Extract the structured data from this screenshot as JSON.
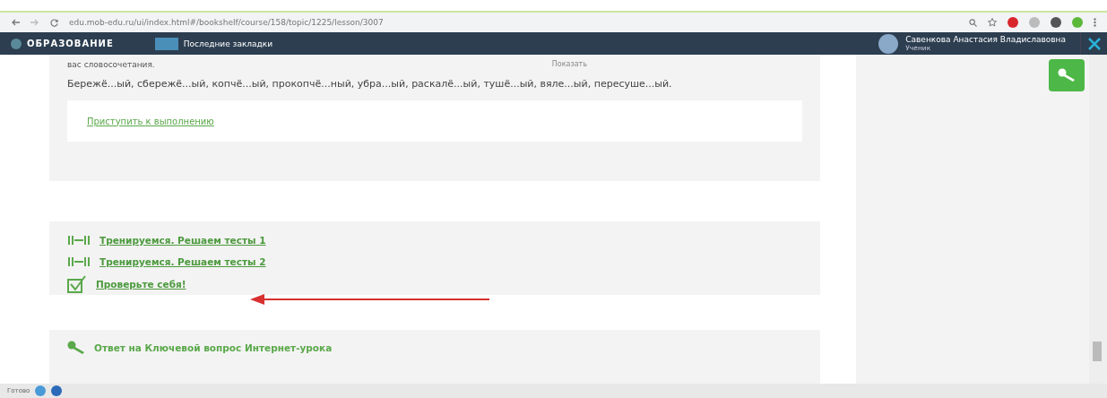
{
  "browser": {
    "url": "edu.mob-edu.ru/ui/index.html#/bookshelf/course/158/topic/1225/lesson/3007"
  },
  "header": {
    "logo": "ОБРАЗОВАНИЕ",
    "bookmarks": "Последние закладки",
    "user_name": "Савенкова Анастасия Владиславовна",
    "user_role": "Ученик"
  },
  "task": {
    "intro": "вас словосочетания.",
    "show_link": "Показать",
    "words": "Бережё...ый, сбережё...ый, копчё...ый, прокопчё...ный, убра...ый, раскалё...ый, тушё...ый, вяле...ый, пересуше...ый.",
    "start_link": "Приступить к выполнению"
  },
  "links": [
    {
      "kind": "test",
      "label": "Тренируемся. Решаем тесты 1"
    },
    {
      "kind": "test",
      "label": "Тренируемся. Решаем тесты 2"
    },
    {
      "kind": "check",
      "label": "Проверьте себя!"
    }
  ],
  "answer": {
    "label": "Ответ на Ключевой вопрос Интернет-урока"
  },
  "status_bar": {
    "text": "Готово"
  }
}
